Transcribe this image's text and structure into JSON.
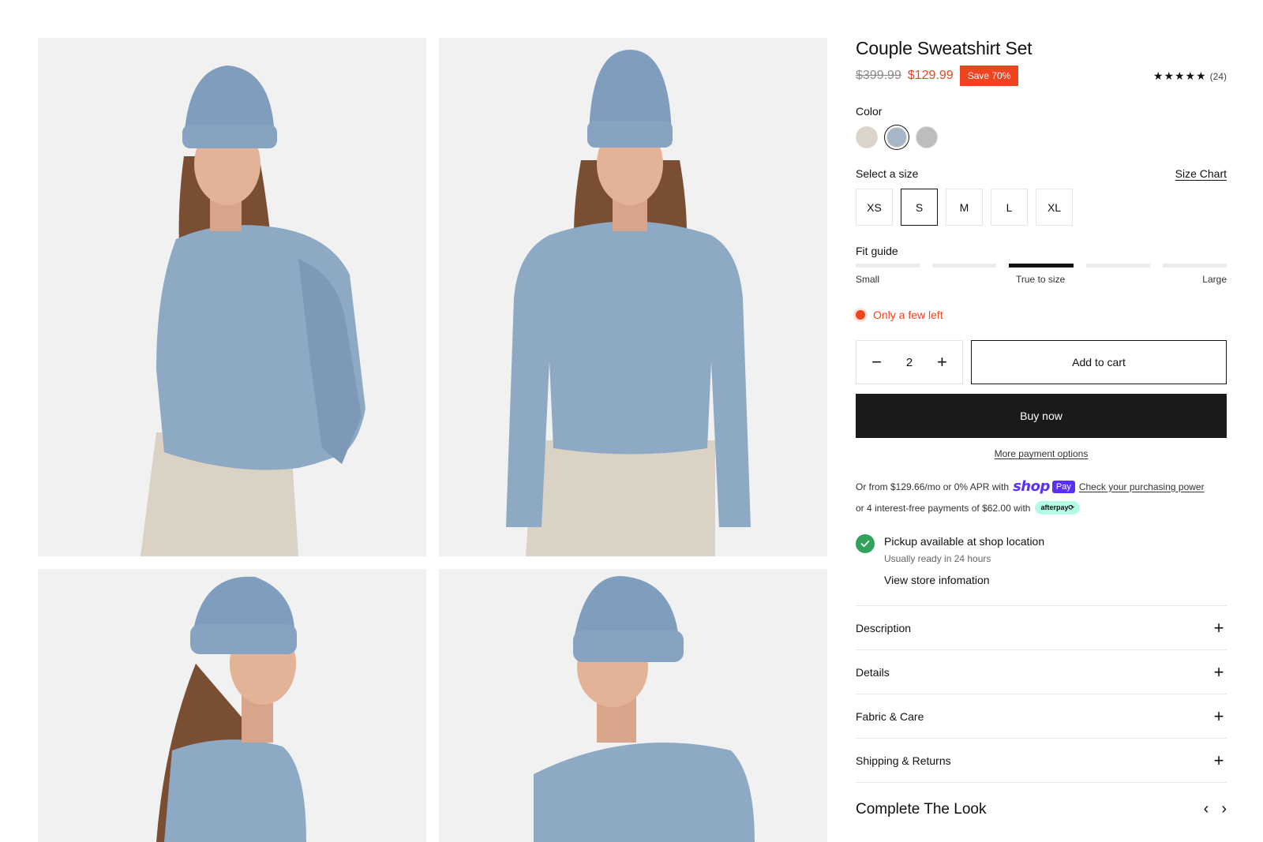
{
  "product": {
    "title": "Couple Sweatshirt Set",
    "old_price": "$399.99",
    "new_price": "$129.99",
    "save_badge": "Save 70%",
    "rating_stars": "★★★★★",
    "rating_count": "(24)"
  },
  "color": {
    "label": "Color",
    "options": [
      {
        "name": "beige",
        "hex": "#dcd4c8",
        "selected": false
      },
      {
        "name": "light-blue",
        "hex": "#a7b6c6",
        "selected": true
      },
      {
        "name": "grey",
        "hex": "#bdbdbd",
        "selected": false
      }
    ]
  },
  "size": {
    "label": "Select a size",
    "chart_link": "Size Chart",
    "options": [
      "XS",
      "S",
      "M",
      "L",
      "XL"
    ],
    "selected": "S"
  },
  "fit": {
    "label": "Fit guide",
    "scale_left": "Small",
    "scale_mid": "True to size",
    "scale_right": "Large",
    "active_segment": 3
  },
  "stock": {
    "text": "Only a few left"
  },
  "cart": {
    "quantity": "2",
    "minus": "−",
    "plus": "+",
    "add_to_cart": "Add to cart",
    "buy_now": "Buy now",
    "more_payment": "More payment options"
  },
  "financing": {
    "shoppay_prefix": "Or from $129.66/mo or 0% APR with",
    "shop_word": "shop",
    "pay_word": "Pay",
    "shoppay_link": "Check your purchasing power",
    "afterpay_prefix": "or 4 interest-free payments of $62.00 with",
    "afterpay_badge": "afterpay⟳"
  },
  "pickup": {
    "title": "Pickup available at shop location",
    "subtitle": "Usually ready in 24 hours",
    "store_link": "View store infomation"
  },
  "accordion": {
    "items": [
      "Description",
      "Details",
      "Fabric & Care",
      "Shipping & Returns"
    ],
    "plus": "+"
  },
  "complete_look": {
    "title": "Complete The Look",
    "prev": "‹",
    "next": "›"
  }
}
